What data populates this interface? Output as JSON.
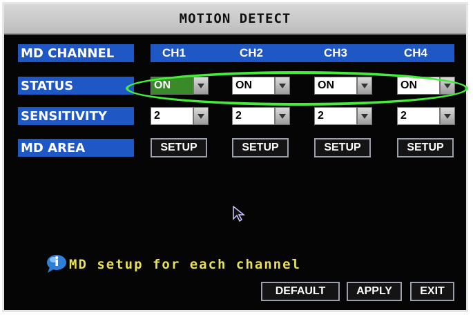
{
  "window": {
    "title": "MOTION DETECT"
  },
  "rows": {
    "md_channel": "MD CHANNEL",
    "status": "STATUS",
    "sensitivity": "SENSITIVITY",
    "md_area": "MD AREA"
  },
  "channels": [
    "CH1",
    "CH2",
    "CH3",
    "CH4"
  ],
  "status_values": [
    "ON",
    "ON",
    "ON",
    "ON"
  ],
  "sensitivity_values": [
    "2",
    "2",
    "2",
    "2"
  ],
  "area_buttons": [
    "SETUP",
    "SETUP",
    "SETUP",
    "SETUP"
  ],
  "hint": {
    "text": "MD setup for each channel",
    "icon": "info-bubble-icon"
  },
  "footer": {
    "default_label": "DEFAULT",
    "apply_label": "APPLY",
    "exit_label": "EXIT"
  },
  "colors": {
    "label_blue": "#1f58c4",
    "selected_green": "#3a8a2a",
    "highlight_ellipse": "#46ec3a",
    "hint_yellow": "#e8e05a",
    "background": "#050505"
  }
}
